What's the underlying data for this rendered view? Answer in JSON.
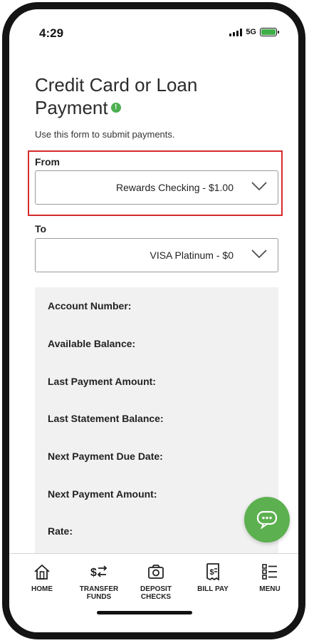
{
  "status_bar": {
    "time": "4:29",
    "network": "5G",
    "battery_icon": "battery-charging-icon"
  },
  "page": {
    "title_line1": "Credit Card or Loan",
    "title_line2": "Payment",
    "info_icon": "info-icon",
    "subtitle": "Use this form to submit payments."
  },
  "form": {
    "from_label": "From",
    "from_value": "Rewards Checking - $1.00",
    "to_label": "To",
    "to_value": "VISA Platinum - $0"
  },
  "details": {
    "rows": [
      "Account Number:",
      "Available Balance:",
      "Last Payment Amount:",
      "Last Statement Balance:",
      "Next Payment Due Date:",
      "Next Payment Amount:",
      "Rate:"
    ]
  },
  "nav": {
    "items": [
      {
        "line1": "HOME",
        "line2": "",
        "icon": "home-icon"
      },
      {
        "line1": "TRANSFER",
        "line2": "FUNDS",
        "icon": "transfer-icon"
      },
      {
        "line1": "DEPOSIT",
        "line2": "CHECKS",
        "icon": "camera-icon"
      },
      {
        "line1": "BILL PAY",
        "line2": "",
        "icon": "bill-icon"
      },
      {
        "line1": "MENU",
        "line2": "",
        "icon": "menu-list-icon"
      }
    ]
  },
  "colors": {
    "accent_green": "#5cb04f",
    "highlight_red": "#d52b2b",
    "panel_gray": "#f1f1f1"
  }
}
